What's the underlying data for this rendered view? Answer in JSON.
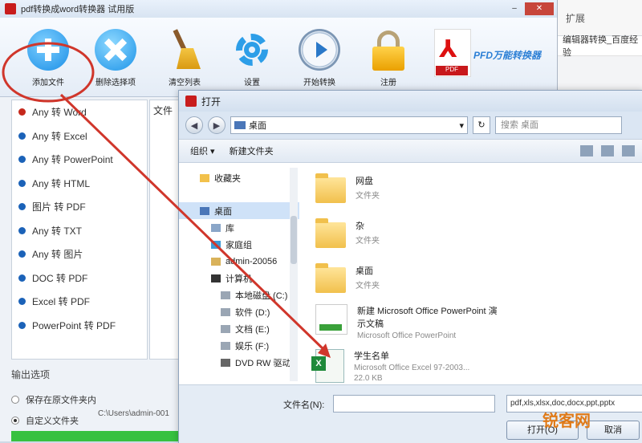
{
  "app": {
    "title": "pdf转换成word转换器 试用版",
    "brand": "PFD万能转换器",
    "pdf_tag": "PDF"
  },
  "toolbar": [
    {
      "label": "添加文件",
      "icon": "plus-circle-icon"
    },
    {
      "label": "删除选择项",
      "icon": "delete-x-icon"
    },
    {
      "label": "清空列表",
      "icon": "broom-icon"
    },
    {
      "label": "设置",
      "icon": "gear-icon"
    },
    {
      "label": "开始转换",
      "icon": "play-icon"
    },
    {
      "label": "注册",
      "icon": "lock-icon"
    }
  ],
  "conversions": [
    {
      "label": "Any 转 Word",
      "color": "red"
    },
    {
      "label": "Any 转 Excel",
      "color": "blue"
    },
    {
      "label": "Any 转 PowerPoint",
      "color": "blue"
    },
    {
      "label": "Any 转 HTML",
      "color": "blue"
    },
    {
      "label": "图片 转 PDF",
      "color": "blue"
    },
    {
      "label": "Any 转 TXT",
      "color": "blue"
    },
    {
      "label": "Any 转 图片",
      "color": "blue"
    },
    {
      "label": "DOC 转 PDF",
      "color": "blue"
    },
    {
      "label": "Excel 转 PDF",
      "color": "blue"
    },
    {
      "label": "PowerPoint 转 PDF",
      "color": "blue"
    }
  ],
  "file_column_header": "文件",
  "output": {
    "title": "输出选项",
    "opt1": "保存在原文件夹内",
    "opt2": "自定义文件夹",
    "path": "C:\\Users\\admin-001"
  },
  "bg_app": {
    "menu": "扩展",
    "line": "编辑器转换_百度经验"
  },
  "dialog": {
    "title": "打开",
    "address": "桌面",
    "search_placeholder": "搜索 桌面",
    "organize": "组织 ▾",
    "new_folder": "新建文件夹",
    "nav": {
      "favorites": "收藏夹",
      "desktop": "桌面",
      "lib": "库",
      "homegroup": "家庭组",
      "user": "admin-20056",
      "computer": "计算机",
      "drive_c": "本地磁盘 (C:)",
      "drive_d": "软件 (D:)",
      "drive_e": "文档 (E:)",
      "drive_f": "娱乐 (F:)",
      "dvd": "DVD RW 驱动"
    },
    "files": [
      {
        "name": "网盘",
        "type": "文件夹"
      },
      {
        "name": "杂",
        "type": "文件夹"
      },
      {
        "name": "桌面",
        "type": "文件夹"
      },
      {
        "name": "新建 Microsoft Office PowerPoint 演示文稿",
        "type": "Microsoft Office PowerPoint"
      },
      {
        "name": "学生名单",
        "type": "Microsoft Office Excel 97-2003...",
        "size": "22.0 KB"
      }
    ],
    "filename_label": "文件名(N):",
    "filetype": "pdf,xls,xlsx,doc,docx,ppt,pptx",
    "open_label": "打开(O)",
    "cancel_label": "取消"
  },
  "watermark": "锐客网",
  "colors": {
    "accent": "#2c7fd5",
    "annotation": "#d0362b",
    "progress": "#37c140"
  }
}
